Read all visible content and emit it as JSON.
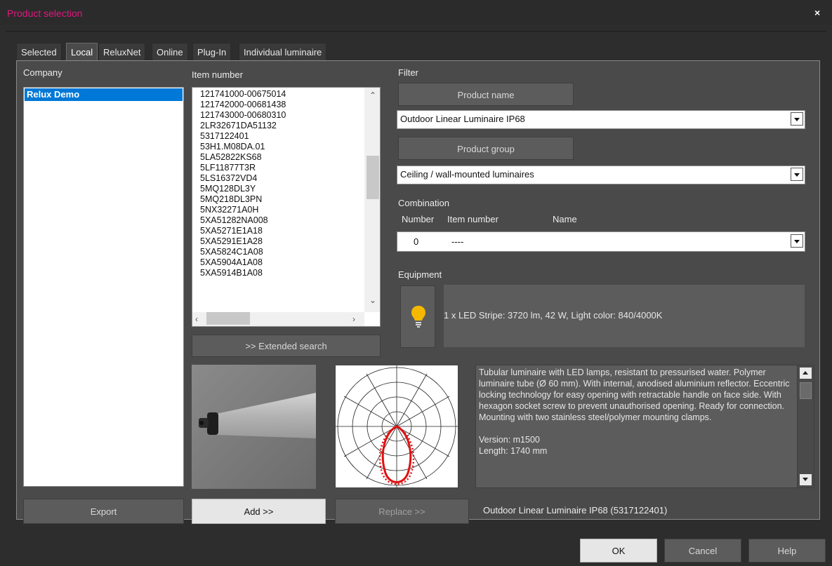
{
  "window": {
    "title": "Product selection",
    "close_glyph": "×"
  },
  "tabs": [
    {
      "label": "Selected"
    },
    {
      "label": "Local",
      "active": true
    },
    {
      "label": "ReluxNet"
    },
    {
      "label": "Online"
    },
    {
      "label": "Plug-In"
    },
    {
      "label": "Individual luminaire"
    }
  ],
  "company": {
    "label": "Company",
    "items": [
      "Relux Demo"
    ],
    "selected": "Relux Demo"
  },
  "items": {
    "label": "Item number",
    "list": [
      "121741000-00675014",
      "121742000-00681438",
      "121743000-00680310",
      "2LR32671DA51132",
      "5317122401",
      "53H1.M08DA.01",
      "5LA52822KS68",
      "5LF11877T3R",
      "5LS16372VD4",
      "5MQ128DL3Y",
      "5MQ218DL3PN",
      "5NX32271A0H",
      "5XA51282NA008",
      "5XA5271E1A18",
      "5XA5291E1A28",
      "5XA5824C1A08",
      "5XA5904A1A08",
      "5XA5914B1A08"
    ],
    "extended_search": ">> Extended search"
  },
  "filter": {
    "label": "Filter",
    "product_name_button": "Product name",
    "product_name_value": "Outdoor Linear Luminaire IP68",
    "product_group_button": "Product group",
    "product_group_value": "Ceiling / wall-mounted luminaires"
  },
  "combination": {
    "label": "Combination",
    "col_number": "Number",
    "col_item": "Item number",
    "col_name": "Name",
    "number_value": "0",
    "item_value": "----"
  },
  "equipment": {
    "label": "Equipment",
    "icon": "lightbulb-icon",
    "text": "1 x LED Stripe: 3720 lm, 42 W, Light color: 840/4000K"
  },
  "description": {
    "paragraph": "Tubular luminaire with LED lamps, resistant to pressurised water. Polymer luminaire tube (Ø 60 mm). With internal, anodised aluminium reflector. Eccentric locking technology for easy opening with retractable handle on face side. With hexagon socket screw to prevent unauthorised opening. Ready for connection. Mounting with two stainless steel/polymer mounting clamps.",
    "version": "Version: m1500",
    "length": "Length: 1740 mm"
  },
  "actions": {
    "export": "Export",
    "add": "Add >>",
    "replace": "Replace >>",
    "selected_product": "Outdoor Linear Luminaire IP68 (5317122401)"
  },
  "footer": {
    "ok": "OK",
    "cancel": "Cancel",
    "help": "Help"
  },
  "colors": {
    "title_accent": "#e0187f",
    "selection": "#0078d7",
    "polar_curve": "#e01010",
    "bulb": "#f5b800"
  }
}
